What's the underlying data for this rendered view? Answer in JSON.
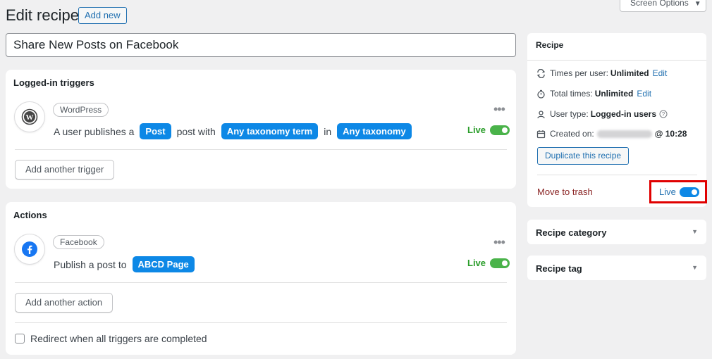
{
  "header": {
    "title": "Edit recipe",
    "add_new": "Add new",
    "screen_options": "Screen Options"
  },
  "recipe_title": "Share New Posts on Facebook",
  "triggers": {
    "heading": "Logged-in triggers",
    "integration": "WordPress",
    "sentence": {
      "t1": "A user publishes a",
      "token1": "Post",
      "t2": "post with",
      "token2": "Any taxonomy term",
      "t3": "in",
      "token3": "Any taxonomy"
    },
    "status": "Live",
    "add_button": "Add another trigger"
  },
  "actions": {
    "heading": "Actions",
    "integration": "Facebook",
    "sentence": {
      "t1": "Publish a post to",
      "token1": "ABCD Page"
    },
    "status": "Live",
    "add_button": "Add another action",
    "redirect_label": "Redirect when all triggers are completed"
  },
  "sidebar": {
    "heading": "Recipe",
    "times_per_user_label": "Times per user:",
    "times_per_user_value": "Unlimited",
    "total_times_label": "Total times:",
    "total_times_value": "Unlimited",
    "edit": "Edit",
    "user_type_label": "User type:",
    "user_type_value": "Logged-in users",
    "created_on_label": "Created on:",
    "created_on_time": "@ 10:28",
    "duplicate_button": "Duplicate this recipe",
    "move_to_trash": "Move to trash",
    "status": "Live",
    "category_panel": "Recipe category",
    "tag_panel": "Recipe tag"
  },
  "colors": {
    "accent": "#2271b1",
    "token": "#0d88e6",
    "live_green": "#2a9d2a",
    "toggle_blue": "#0d88e6",
    "trash": "#8a2424",
    "highlight": "#e00000"
  }
}
